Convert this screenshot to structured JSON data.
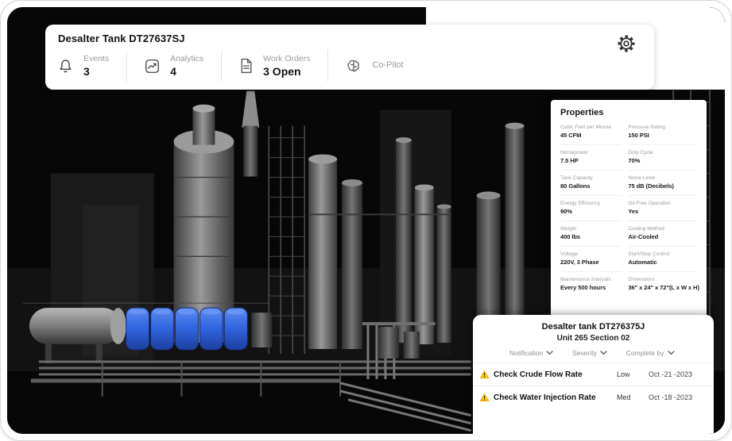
{
  "toolbar": {
    "title": "Desalter Tank DT27637SJ",
    "metrics": [
      {
        "icon": "bell-icon",
        "label": "Events",
        "value": "3"
      },
      {
        "icon": "analytics-icon",
        "label": "Analytics",
        "value": "4"
      },
      {
        "icon": "work-orders-icon",
        "label": "Work Orders",
        "value": "3 Open"
      },
      {
        "icon": "copilot-icon",
        "label": "Co-Pilot",
        "value": ""
      }
    ],
    "settings_icon": "gear-icon"
  },
  "properties_panel": {
    "title": "Properties",
    "items": [
      {
        "label": "Cubic Feet per Minute",
        "value": "45 CFM"
      },
      {
        "label": "Pressure Rating",
        "value": "150 PSI"
      },
      {
        "label": "Horsepower",
        "value": "7.5 HP"
      },
      {
        "label": "Duty Cycle",
        "value": "70%"
      },
      {
        "label": "Tank Capacity",
        "value": "80 Gallons"
      },
      {
        "label": "Noise Level",
        "value": "75 dB (Decibels)"
      },
      {
        "label": "Energy Efficiency",
        "value": "90%"
      },
      {
        "label": "Oil-Free Operation",
        "value": "Yes"
      },
      {
        "label": "Weight",
        "value": "400 lbs"
      },
      {
        "label": "Cooling Method",
        "value": "Air-Cooled"
      },
      {
        "label": "Voltage",
        "value": "220V, 3 Phase"
      },
      {
        "label": "Start/Stop Control",
        "value": "Automatic"
      },
      {
        "label": "Maintenance Intervals",
        "value": "Every 500 hours"
      },
      {
        "label": "Dimensions",
        "value": "36\" x 24\" x 72\"(L x W x H)"
      }
    ]
  },
  "task_panel": {
    "title": "Desalter tank DT276375J",
    "subtitle": "Unit 265 Section 02",
    "filters": [
      {
        "label": "Notification",
        "icon": "chevron-down-icon"
      },
      {
        "label": "Severity",
        "icon": "chevron-down-icon"
      },
      {
        "label": "Complete by",
        "icon": "chevron-down-icon"
      }
    ],
    "tasks": [
      {
        "icon": "warning-icon",
        "name": "Check Crude Flow Rate",
        "severity": "Low",
        "complete_by": "Oct -21 -2023"
      },
      {
        "icon": "warning-icon",
        "name": "Check Water Injection Rate",
        "severity": "Med",
        "complete_by": "Oct -18 -2023"
      }
    ]
  },
  "colors": {
    "highlight_blue": "#2f63dd",
    "warning_yellow": "#ffc400",
    "panel_border": "#ececec",
    "muted_text": "#9a9a9a"
  }
}
